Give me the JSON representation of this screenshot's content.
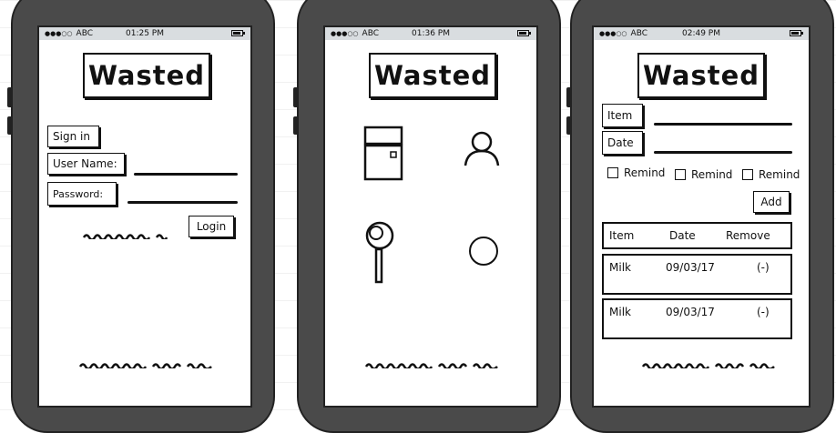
{
  "status": {
    "carrier": "ABC",
    "signal_dots": "●●●○○",
    "times": [
      "01:25 PM",
      "01:36 PM",
      "02:49 PM"
    ]
  },
  "app": {
    "logo": "Wasted"
  },
  "screen1": {
    "signin_label": "Sign in",
    "username_label": "User Name:",
    "password_label": "Password:",
    "login_button": "Login"
  },
  "screen2": {
    "icons": [
      "fridge-icon",
      "user-icon",
      "magnifier-icon",
      "circle-icon"
    ]
  },
  "screen3": {
    "item_label": "Item",
    "date_label": "Date",
    "remind_labels": [
      "Remind",
      "Remind",
      "Remind"
    ],
    "add_button": "Add",
    "table": {
      "headers": [
        "Item",
        "Date",
        "Remove"
      ],
      "rows": [
        {
          "item": "Milk",
          "date": "09/03/17",
          "remove": "(-)"
        },
        {
          "item": "Milk",
          "date": "09/03/17",
          "remove": "(-)"
        }
      ]
    }
  }
}
